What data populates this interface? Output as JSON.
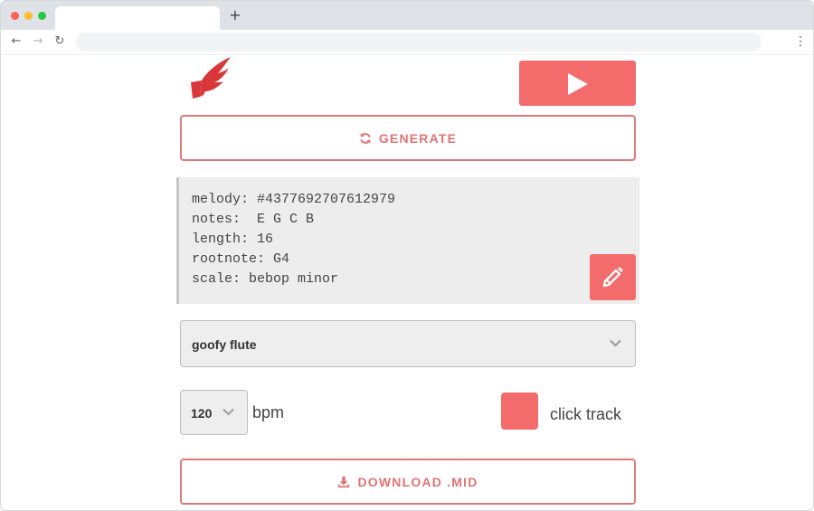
{
  "browser": {
    "new_tab_glyph": "+",
    "back_glyph": "←",
    "forward_glyph": "→",
    "reload_glyph": "↻",
    "menu_glyph": "⋮"
  },
  "icons": {
    "logo": "wing-note-logo",
    "play": "play-icon",
    "generate": "refresh-icon",
    "edit": "pencil-icon",
    "select_chevron": "chevron-down-icon",
    "download": "download-icon"
  },
  "colors": {
    "accent": "#f46b6b",
    "outline_text": "#e07373",
    "logo": "#d9383a",
    "panel_bg": "#ededed"
  },
  "main": {
    "generate_label": "GENERATE",
    "melody": {
      "id_line": "melody: #4377692707612979",
      "notes_line": "notes:  E G C B",
      "length_line": "length: 16",
      "root_line": "rootnote: G4",
      "scale_line": "scale: bebop minor"
    },
    "instrument": "goofy flute",
    "bpm": {
      "value": "120",
      "unit_label": "bpm"
    },
    "click_track_label": "click track",
    "download_label": "DOWNLOAD .MID"
  }
}
